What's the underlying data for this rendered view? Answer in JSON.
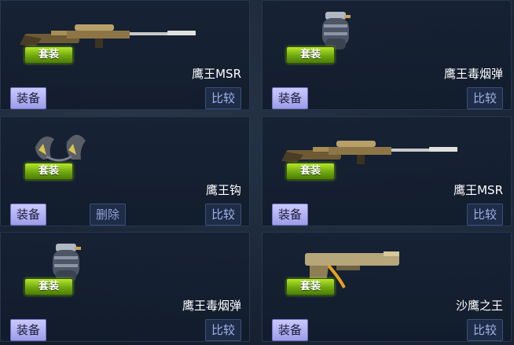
{
  "cards": [
    {
      "badge": "套装",
      "name": "鹰王MSR",
      "equip": "装备",
      "compare": "比较",
      "icon": "sniper-rifle-icon"
    },
    {
      "badge": "套装",
      "name": "鹰王毒烟弹",
      "equip": "装备",
      "compare": "比较",
      "icon": "smoke-grenade-icon"
    },
    {
      "badge": "套装",
      "name": "鹰王钩",
      "equip": "装备",
      "delete": "删除",
      "compare": "比较",
      "icon": "claw-hooks-icon"
    },
    {
      "badge": "套装",
      "name": "鹰王MSR",
      "equip": "装备",
      "compare": "比较",
      "icon": "sniper-rifle-icon"
    },
    {
      "badge": "套装",
      "name": "鹰王毒烟弹",
      "equip": "装备",
      "compare": "比较",
      "icon": "smoke-grenade-icon"
    },
    {
      "badge": "套装",
      "name": "沙鹰之王",
      "equip": "装备",
      "compare": "比较",
      "icon": "pistol-icon"
    }
  ],
  "colors": {
    "badge_green": "#8bc81a",
    "equip_button": "#b3b3f5",
    "compare_button": "#1e2c48",
    "card_background": "#16223a"
  }
}
